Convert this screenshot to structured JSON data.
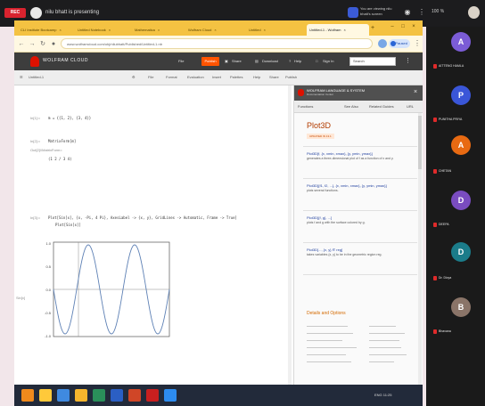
{
  "colors": {
    "accent_orange": "#ff5400",
    "chrome_yellow": "#f4c242",
    "wolfram_red": "#dd1100",
    "rec_red": "#d9232f",
    "doc_title": "#b23c00",
    "link_blue": "#1e3e9e"
  },
  "meeting": {
    "rec_label": "REC",
    "share_title": "nilu bhatt is presenting",
    "host_text": "You are viewing nilu bhatt's screen",
    "zoom_label": "100 %",
    "icons": [
      "record-icon",
      "screen-share-icon",
      "audio-icon",
      "more-icon",
      "profile-icon"
    ]
  },
  "browser": {
    "tabs": [
      {
        "label": "CLI Institute Bootcamp",
        "active": false
      },
      {
        "label": "Untitled Notebook",
        "active": false
      },
      {
        "label": "Mathematica",
        "active": false
      },
      {
        "label": "Wolfram Cloud",
        "active": false
      },
      {
        "label": "Untitled",
        "active": false
      },
      {
        "label": "Untitled-1 - Wolfram",
        "active": true
      }
    ],
    "url": "www.wolframcloud.com/obj/nilubhatt/Published/Untitled-1.nb",
    "paused_label": "Paused"
  },
  "wolfram": {
    "brand": "WOLFRAM CLOUD",
    "menu": [
      "File",
      "Publish",
      "Share",
      "Download",
      "Help",
      "Sign In"
    ],
    "publish_label": "Publish",
    "search_placeholder": "Search",
    "toolbar": [
      "Untitled-1",
      "File",
      "Format",
      "Evaluation",
      "Insert",
      "Palettes",
      "Help",
      "Share",
      "Publish"
    ]
  },
  "notebook": {
    "cells": [
      {
        "label": "In[1]:=",
        "code": "m = {{1, 2}, {3, 4}}"
      },
      {
        "label": "In[2]:=",
        "code": "MatrixForm[m]"
      },
      {
        "label": "Out[2]//MatrixForm=",
        "code": "(1 2 / 3 4)"
      },
      {
        "label": "In[3]:=",
        "code": "Plot[Sin[x], {x, -Pi, 4 Pi}, AxesLabel -> {x, y}, GridLines -> Automatic, Frame -> True]"
      },
      {
        "label": "",
        "code": "Plot[Sin[x]]"
      }
    ],
    "plot_axis_label": "Sin[x]",
    "plot_ticks": [
      "1.0",
      "0.5",
      "0.0",
      "-0.5",
      "-1.0"
    ]
  },
  "docs": {
    "header_title": "WOLFRAM LANGUAGE & SYSTEM",
    "header_sub": "Documentation Center",
    "nav": [
      "Functions",
      "See Also",
      "Related Guides",
      "URL"
    ],
    "title": "Plot3D",
    "badge": "UPDATED IN 13.1",
    "entries": [
      {
        "sig": "Plot3D[f, {x, xmin, xmax}, {y, ymin, ymax}]",
        "desc": "generates a three-dimensional plot of f as a function of x and y."
      },
      {
        "sig": "Plot3D[{f1, f2, ...}, {x, xmin, xmax}, {y, ymin, ymax}]",
        "desc": "plots several functions."
      },
      {
        "sig": "Plot3D[{f, g}, ...]",
        "desc": "plots f and g with the surface colored by g."
      },
      {
        "sig": "Plot3D[..., {x, y} ∈ reg]",
        "desc": "takes variables {x, y} to be in the geometric region reg."
      }
    ],
    "details_label": "Details and Options"
  },
  "taskbar": {
    "apps": [
      "windows-start",
      "file-explorer",
      "chrome",
      "mail",
      "store",
      "word",
      "powerpoint",
      "adobe-reader",
      "zoom"
    ],
    "tray": "ENG 11:25"
  },
  "participants": [
    {
      "initial": "A",
      "name": "AITTENG HAMLA",
      "color": "#7b5cd6"
    },
    {
      "initial": "P",
      "name": "PUNITHA PRIYA",
      "color": "#3a56d8"
    },
    {
      "initial": "A",
      "name": "CHETAN",
      "color": "#e86a12"
    },
    {
      "initial": "D",
      "name": "DEEPA",
      "color": "#7a4cc0"
    },
    {
      "initial": "D",
      "name": "Dr. Divya",
      "color": "#1b7c8a"
    },
    {
      "initial": "B",
      "name": "Bhavana",
      "color": "#8a7468"
    }
  ]
}
